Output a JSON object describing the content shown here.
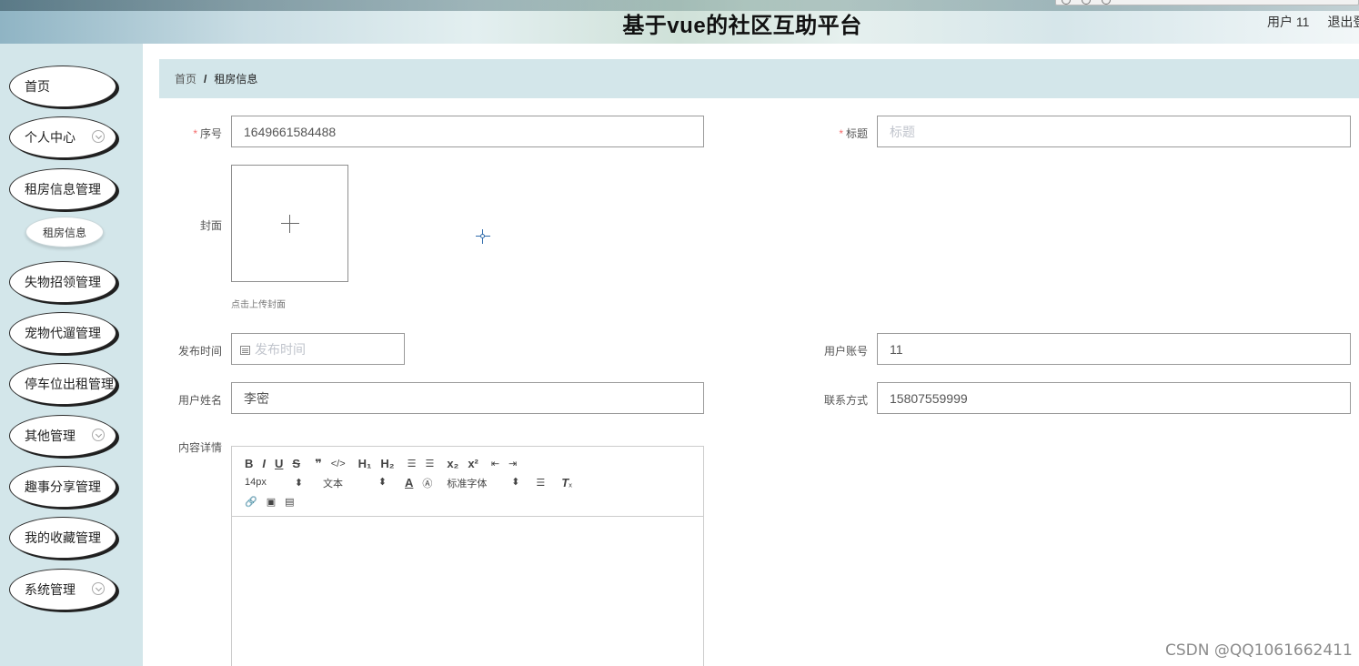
{
  "header": {
    "title": "基于vue的社区互助平台",
    "user_label": "用户 11",
    "logout_label": "退出登录"
  },
  "sidebar": {
    "items": [
      {
        "label": "首页"
      },
      {
        "label": "个人中心"
      },
      {
        "label": "租房信息管理"
      },
      {
        "label": "租房信息"
      },
      {
        "label": "失物招领管理"
      },
      {
        "label": "宠物代遛管理"
      },
      {
        "label": "停车位出租管理"
      },
      {
        "label": "其他管理"
      },
      {
        "label": "趣事分享管理"
      },
      {
        "label": "我的收藏管理"
      },
      {
        "label": "系统管理"
      }
    ]
  },
  "breadcrumb": {
    "home": "首页",
    "separator": "/",
    "current": "租房信息"
  },
  "form": {
    "serial_label": "序号",
    "serial_value": "1649661584488",
    "title_label": "标题",
    "title_placeholder": "标题",
    "cover_label": "封面",
    "cover_hint": "点击上传封面",
    "publish_time_label": "发布时间",
    "publish_time_placeholder": "发布时间",
    "account_label": "用户账号",
    "account_value": "11",
    "name_label": "用户姓名",
    "name_value": "李密",
    "contact_label": "联系方式",
    "contact_value": "15807559999",
    "content_label": "内容详情",
    "required_mark": "*"
  },
  "editor": {
    "row1": [
      "B",
      "I",
      "U",
      "S",
      "99",
      "</>",
      "H1",
      "H2",
      "ol",
      "ul",
      "x2",
      "x2",
      "outdent",
      "indent"
    ],
    "font_size": "14px",
    "text_type": "文本",
    "font_family": "标准字体"
  },
  "watermark": "CSDN @QQ1061662411"
}
